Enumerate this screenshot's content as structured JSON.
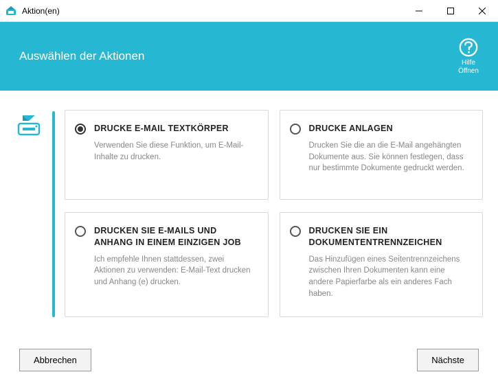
{
  "window": {
    "title": "Aktion(en)"
  },
  "header": {
    "title": "Auswählen der Aktionen",
    "help_line1": "Hilfe",
    "help_line2": "Öffnen"
  },
  "options": [
    {
      "title": "DRUCKE E-MAIL TEXTKÖRPER",
      "desc": "Verwenden Sie diese Funktion, um E-Mail-Inhalte zu drucken.",
      "selected": true
    },
    {
      "title": "DRUCKE ANLAGEN",
      "desc": "Drucken Sie die an die E-Mail angehängten Dokumente aus. Sie können festlegen, dass nur bestimmte Dokumente gedruckt werden.",
      "selected": false
    },
    {
      "title": "DRUCKEN SIE E-MAILS UND ANHANG IN EINEM EINZIGEN JOB",
      "desc": "Ich empfehle Ihnen stattdessen, zwei Aktionen zu verwenden: E-Mail-Text drucken und Anhang (e) drucken.",
      "selected": false
    },
    {
      "title": "DRUCKEN SIE EIN DOKUMENTENTRENNZEICHEN",
      "desc": "Das Hinzufügen eines Seitentrennzeichens zwischen Ihren Dokumenten kann eine andere Papierfarbe als ein anderes Fach haben.",
      "selected": false
    }
  ],
  "footer": {
    "cancel": "Abbrechen",
    "next": "Nächste"
  }
}
